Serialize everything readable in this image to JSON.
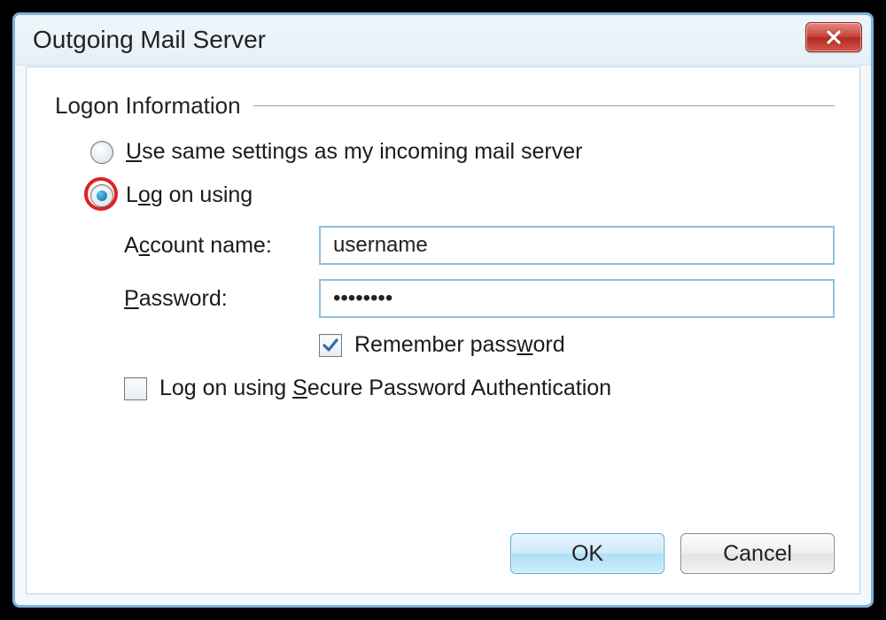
{
  "dialog": {
    "title": "Outgoing Mail Server"
  },
  "group": {
    "legend": "Logon Information"
  },
  "radios": {
    "same_settings": {
      "prefix": "",
      "accel": "U",
      "suffix": "se same settings as my incoming mail server",
      "selected": false
    },
    "log_on_using": {
      "prefix": "L",
      "accel": "o",
      "suffix": "g on using",
      "selected": true,
      "highlighted": true
    }
  },
  "fields": {
    "account": {
      "label_prefix": "A",
      "label_accel": "c",
      "label_suffix": "count name:",
      "value": "username"
    },
    "password": {
      "label_prefix": "",
      "label_accel": "P",
      "label_suffix": "assword:",
      "value": "••••••••"
    }
  },
  "checkboxes": {
    "remember": {
      "prefix": "Remember pass",
      "accel": "w",
      "suffix": "ord",
      "checked": true
    },
    "spa": {
      "prefix": "Log on using ",
      "accel": "S",
      "suffix": "ecure Password Authentication",
      "checked": false
    }
  },
  "buttons": {
    "ok": "OK",
    "cancel": "Cancel"
  }
}
